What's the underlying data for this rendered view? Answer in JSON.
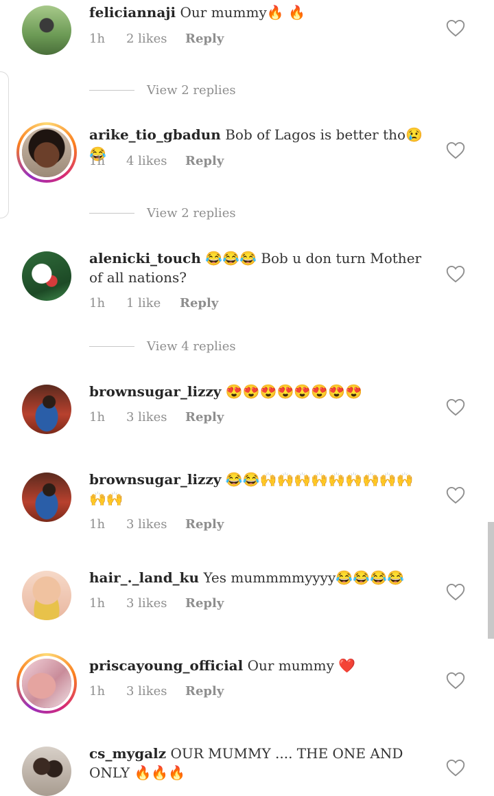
{
  "colors": {
    "text": "#262626",
    "meta": "#8e8e8e",
    "ring_start": "#feda75",
    "ring_end": "#d62976",
    "heart_outline": "#8e8e8e"
  },
  "comments": [
    {
      "username": "feliciannaji",
      "message": "Our mummy🔥 🔥",
      "time": "1h",
      "likes": "2 likes",
      "reply": "Reply",
      "icon": "heart-outline-icon"
    },
    {
      "username": "arike_tio_gbadun",
      "message": "Bob of Lagos is better tho😢😂",
      "time": "1h",
      "likes": "4 likes",
      "reply": "Reply",
      "icon": "heart-outline-icon"
    },
    {
      "username": "alenicki_touch",
      "message": "😂😂😂 Bob u don turn Mother of all nations?",
      "time": "1h",
      "likes": "1 like",
      "reply": "Reply",
      "icon": "heart-outline-icon"
    },
    {
      "username": "brownsugar_lizzy",
      "message": "😍😍😍😍😍😍😍😍",
      "time": "1h",
      "likes": "3 likes",
      "reply": "Reply",
      "icon": "heart-outline-icon"
    },
    {
      "username": "brownsugar_lizzy",
      "message": "😂😂🙌🙌🙌🙌🙌🙌🙌🙌🙌🙌🙌",
      "time": "1h",
      "likes": "3 likes",
      "reply": "Reply",
      "icon": "heart-outline-icon"
    },
    {
      "username": "hair_._land_ku",
      "message": "Yes mummmmyyyy😂😂😂😂",
      "time": "1h",
      "likes": "3 likes",
      "reply": "Reply",
      "icon": "heart-outline-icon"
    },
    {
      "username": "priscayoung_official",
      "message": "Our mummy ❤️",
      "time": "1h",
      "likes": "3 likes",
      "reply": "Reply",
      "icon": "heart-outline-icon"
    },
    {
      "username": "cs_mygalz",
      "message": "OUR MUMMY .... THE ONE AND ONLY 🔥🔥🔥",
      "time": "",
      "likes": "",
      "reply": "",
      "icon": "heart-outline-icon"
    }
  ],
  "view_replies": [
    {
      "label": "View 2 replies"
    },
    {
      "label": "View 2 replies"
    },
    {
      "label": "View 4 replies"
    }
  ]
}
